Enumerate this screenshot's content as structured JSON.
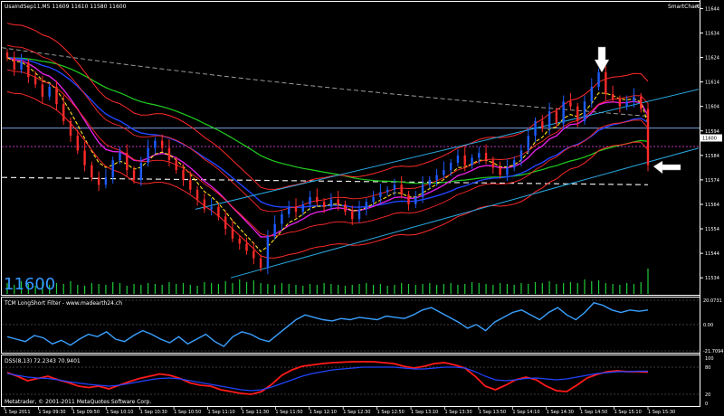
{
  "window": {
    "title": "UsaIndSep11,M5  11609 11610 11580 11600",
    "smartchart_label": "SmartChart",
    "close_symbol": "×",
    "big_price": "11600",
    "copyright": "Metatrader, © 2001-2011 MetaQuotes Software Corp.",
    "arrow_icon": "white-arrow-icon"
  },
  "chart_data": [
    {
      "type": "candlestick",
      "title": "UsaIndSep11,M5",
      "ylim": [
        11530,
        11646
      ],
      "y_ticks": [
        "11644",
        "11634",
        "11624",
        "11614",
        "11604",
        "11594",
        "11584",
        "11574",
        "11564",
        "11554",
        "11544",
        "11534"
      ],
      "current_price_label": "11600",
      "colors": {
        "up": "#1e5cff",
        "down": "#ff2a2a",
        "volume": "#1fcc3a"
      },
      "x_ticks": [
        "1 Sep 2011",
        "1 Sep 09:30",
        "1 Sep 09:50",
        "1 Sep 10:10",
        "1 Sep 10:30",
        "1 Sep 10:50",
        "1 Sep 11:10",
        "1 Sep 11:30",
        "1 Sep 11:50",
        "1 Sep 12:10",
        "1 Sep 12:30",
        "1 Sep 12:50",
        "1 Sep 13:10",
        "1 Sep 13:30",
        "1 Sep 13:50",
        "1 Sep 14:10",
        "1 Sep 14:30",
        "1 Sep 14:50",
        "1 Sep 15:10",
        "1 Sep 15:30"
      ],
      "close": [
        11624,
        11619,
        11622,
        11616,
        11613,
        11608,
        11612,
        11605,
        11598,
        11592,
        11586,
        11580,
        11575,
        11572,
        11575,
        11582,
        11585,
        11578,
        11574,
        11581,
        11587,
        11590,
        11587,
        11582,
        11578,
        11574,
        11570,
        11566,
        11562,
        11563,
        11559,
        11554,
        11550,
        11548,
        11545,
        11542,
        11538,
        11551,
        11556,
        11560,
        11563,
        11561,
        11564,
        11567,
        11565,
        11563,
        11566,
        11564,
        11561,
        11558,
        11562,
        11565,
        11567,
        11569,
        11570,
        11572,
        11568,
        11564,
        11567,
        11572,
        11574,
        11576,
        11578,
        11581,
        11584,
        11580,
        11583,
        11585,
        11582,
        11579,
        11576,
        11579,
        11582,
        11586,
        11592,
        11598,
        11595,
        11602,
        11597,
        11606,
        11604,
        11598,
        11606,
        11612,
        11618,
        11609,
        11607,
        11604,
        11606,
        11608,
        11603,
        11580
      ],
      "volume": [
        12,
        10,
        14,
        11,
        9,
        13,
        10,
        12,
        11,
        14,
        10,
        9,
        12,
        11,
        10,
        13,
        12,
        9,
        11,
        10,
        12,
        11,
        10,
        13,
        11,
        12,
        10,
        9,
        13,
        12,
        11,
        14,
        12,
        16,
        13,
        15,
        12,
        11,
        10,
        12,
        11,
        10,
        9,
        11,
        10,
        12,
        11,
        10,
        9,
        10,
        11,
        12,
        10,
        11,
        9,
        10,
        12,
        11,
        10,
        11,
        12,
        10,
        11,
        12,
        10,
        11,
        13,
        12,
        11,
        10,
        12,
        11,
        10,
        12,
        11,
        13,
        12,
        14,
        11,
        12,
        13,
        12,
        16,
        14,
        15,
        12,
        11,
        10,
        12,
        11,
        13,
        28
      ],
      "ma_series": [
        "white-dashed",
        "gray-dashed",
        "green",
        "blue",
        "magenta",
        "yellow-dashed",
        "red-bands"
      ],
      "channel_color": "#29a8e0"
    },
    {
      "type": "line",
      "title": "TCM LongShort Filter - www.madearth24.ch",
      "y_ticks": [
        "20.0731",
        "0.00",
        "-21.7094"
      ],
      "ylim": [
        -21.7094,
        20.0731
      ],
      "series": [
        {
          "color": "#3aa0ff",
          "values": [
            -10,
            -12,
            -14,
            -9,
            -11,
            -16,
            -13,
            -17,
            -12,
            -8,
            -10,
            -6,
            -12,
            -14,
            -9,
            -5,
            -8,
            -12,
            -15,
            -10,
            -16,
            -12,
            -8,
            -14,
            -18,
            -10,
            -6,
            -8,
            -12,
            -14,
            -8,
            -2,
            4,
            8,
            6,
            4,
            3,
            5,
            4,
            6,
            5,
            4,
            7,
            6,
            5,
            8,
            12,
            14,
            10,
            6,
            2,
            -3,
            0,
            -5,
            2,
            6,
            10,
            12,
            8,
            4,
            10,
            14,
            8,
            4,
            10,
            18,
            16,
            12,
            10,
            12,
            11,
            12
          ]
        }
      ]
    },
    {
      "type": "line",
      "title": "DSS(8,13) 72.2343 70.9401",
      "y_ticks": [
        "100",
        "80",
        "20",
        "0"
      ],
      "ylim": [
        0,
        100
      ],
      "series": [
        {
          "color": "#ff1a1a",
          "values": [
            68,
            60,
            50,
            55,
            60,
            52,
            46,
            38,
            35,
            38,
            32,
            40,
            48,
            55,
            60,
            65,
            62,
            55,
            45,
            40,
            38,
            30,
            26,
            22,
            20,
            26,
            42,
            62,
            74,
            82,
            85,
            88,
            90,
            91,
            92,
            92,
            92,
            90,
            88,
            82,
            78,
            82,
            88,
            90,
            85,
            78,
            60,
            38,
            30,
            40,
            52,
            58,
            52,
            38,
            28,
            26,
            40,
            56,
            64,
            70,
            72,
            70,
            70,
            69
          ]
        },
        {
          "color": "#2244ff",
          "values": [
            66,
            62,
            58,
            56,
            55,
            52,
            48,
            45,
            42,
            40,
            38,
            40,
            44,
            48,
            52,
            55,
            56,
            54,
            50,
            46,
            42,
            38,
            34,
            30,
            28,
            30,
            36,
            44,
            52,
            60,
            66,
            70,
            74,
            76,
            78,
            80,
            80,
            80,
            80,
            78,
            76,
            76,
            78,
            80,
            80,
            78,
            70,
            60,
            52,
            50,
            52,
            55,
            56,
            54,
            52,
            54,
            58,
            62,
            66,
            68,
            70,
            70,
            71,
            71
          ]
        }
      ]
    }
  ]
}
